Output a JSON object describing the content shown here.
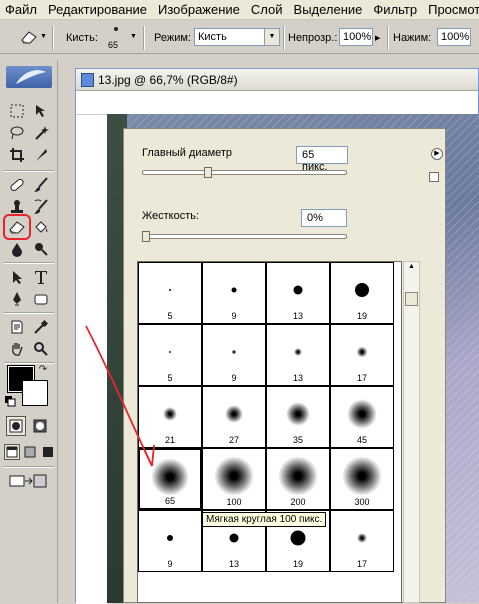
{
  "menu": [
    "Файл",
    "Редактирование",
    "Изображение",
    "Слой",
    "Выделение",
    "Фильтр",
    "Просмотр"
  ],
  "options": {
    "brush_label": "Кисть:",
    "brush_size": "65",
    "mode_label": "Режим:",
    "mode_value": "Кисть",
    "opacity_label": "Непрозр.:",
    "opacity_value": "100%",
    "pressure_label": "Нажим:",
    "pressure_value": "100%"
  },
  "document": {
    "title": "13.jpg @ 66,7% (RGB/8#)"
  },
  "brush_panel": {
    "diameter_label": "Главный диаметр",
    "diameter_value": "65 пикс.",
    "diameter_fraction": 0.32,
    "hardness_label": "Жесткость:",
    "hardness_value": "0%",
    "hardness_fraction": 0.0,
    "presets": [
      {
        "label": "5",
        "soft": false,
        "size": 2
      },
      {
        "label": "9",
        "soft": false,
        "size": 5
      },
      {
        "label": "13",
        "soft": false,
        "size": 9
      },
      {
        "label": "19",
        "soft": false,
        "size": 14
      },
      {
        "label": "5",
        "soft": true,
        "size": 3
      },
      {
        "label": "9",
        "soft": true,
        "size": 5
      },
      {
        "label": "13",
        "soft": true,
        "size": 8
      },
      {
        "label": "17",
        "soft": true,
        "size": 11
      },
      {
        "label": "21",
        "soft": true,
        "size": 14
      },
      {
        "label": "27",
        "soft": true,
        "size": 18
      },
      {
        "label": "35",
        "soft": true,
        "size": 24
      },
      {
        "label": "45",
        "soft": true,
        "size": 30
      },
      {
        "label": "65",
        "soft": true,
        "size": 38,
        "selected": true
      },
      {
        "label": "100",
        "soft": true,
        "size": 40
      },
      {
        "label": "200",
        "soft": true,
        "size": 40
      },
      {
        "label": "300",
        "soft": true,
        "size": 40
      },
      {
        "label": "9",
        "soft": false,
        "size": 6
      },
      {
        "label": "13",
        "soft": false,
        "size": 9
      },
      {
        "label": "19",
        "soft": false,
        "size": 15
      },
      {
        "label": "17",
        "soft": true,
        "size": 10
      }
    ],
    "tooltip": "Мягкая круглая 100 пикс."
  },
  "colors": {
    "accent_red": "#e8242c",
    "foreground": "#000000",
    "background": "#ffffff"
  }
}
